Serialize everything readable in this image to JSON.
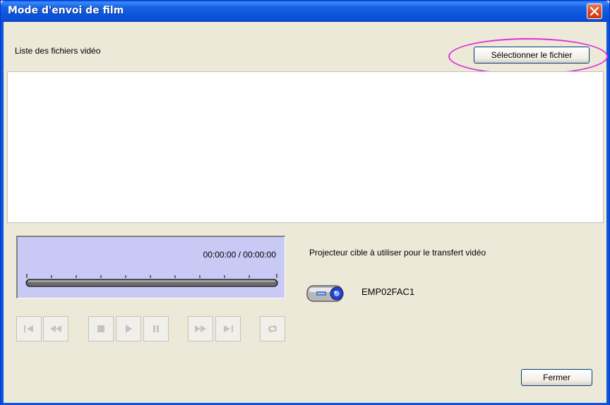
{
  "window": {
    "title": "Mode d'envoi de film"
  },
  "file_section": {
    "label": "Liste des fichiers vidéo",
    "select_button": "Sélectionner le fichier",
    "files": []
  },
  "player": {
    "time_display": "00:00:00 / 00:00:00",
    "controls": [
      {
        "name": "skip-to-start",
        "icon": "skip-back-icon",
        "enabled": false
      },
      {
        "name": "rewind",
        "icon": "rewind-icon",
        "enabled": false
      },
      {
        "name": "stop",
        "icon": "stop-icon",
        "enabled": false
      },
      {
        "name": "play",
        "icon": "play-icon",
        "enabled": false
      },
      {
        "name": "pause",
        "icon": "pause-icon",
        "enabled": false
      },
      {
        "name": "fast-forward",
        "icon": "fast-forward-icon",
        "enabled": false
      },
      {
        "name": "skip-to-end",
        "icon": "skip-forward-icon",
        "enabled": false
      },
      {
        "name": "repeat",
        "icon": "repeat-icon",
        "enabled": false
      }
    ]
  },
  "target": {
    "label": "Projecteur cible à utiliser pour le transfert vidéo",
    "projector_name": "EMP02FAC1",
    "projector_icon": "projector-icon"
  },
  "footer": {
    "close_button": "Fermer"
  },
  "colors": {
    "titlebar": "#0754da",
    "window_bg": "#ece9d8",
    "player_bg": "#c8caf5",
    "highlight": "#e030d8",
    "close_button": "#d9431f"
  }
}
